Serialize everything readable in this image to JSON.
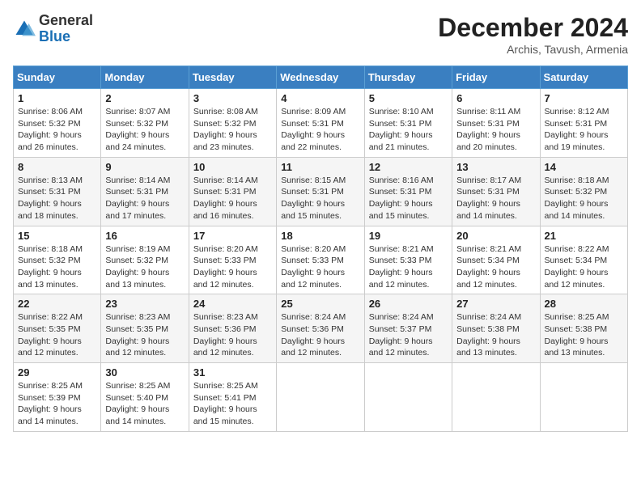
{
  "logo": {
    "general": "General",
    "blue": "Blue"
  },
  "title": "December 2024",
  "subtitle": "Archis, Tavush, Armenia",
  "days_of_week": [
    "Sunday",
    "Monday",
    "Tuesday",
    "Wednesday",
    "Thursday",
    "Friday",
    "Saturday"
  ],
  "weeks": [
    [
      {
        "day": "1",
        "sunrise": "8:06 AM",
        "sunset": "5:32 PM",
        "daylight": "9 hours and 26 minutes."
      },
      {
        "day": "2",
        "sunrise": "8:07 AM",
        "sunset": "5:32 PM",
        "daylight": "9 hours and 24 minutes."
      },
      {
        "day": "3",
        "sunrise": "8:08 AM",
        "sunset": "5:32 PM",
        "daylight": "9 hours and 23 minutes."
      },
      {
        "day": "4",
        "sunrise": "8:09 AM",
        "sunset": "5:31 PM",
        "daylight": "9 hours and 22 minutes."
      },
      {
        "day": "5",
        "sunrise": "8:10 AM",
        "sunset": "5:31 PM",
        "daylight": "9 hours and 21 minutes."
      },
      {
        "day": "6",
        "sunrise": "8:11 AM",
        "sunset": "5:31 PM",
        "daylight": "9 hours and 20 minutes."
      },
      {
        "day": "7",
        "sunrise": "8:12 AM",
        "sunset": "5:31 PM",
        "daylight": "9 hours and 19 minutes."
      }
    ],
    [
      {
        "day": "8",
        "sunrise": "8:13 AM",
        "sunset": "5:31 PM",
        "daylight": "9 hours and 18 minutes."
      },
      {
        "day": "9",
        "sunrise": "8:14 AM",
        "sunset": "5:31 PM",
        "daylight": "9 hours and 17 minutes."
      },
      {
        "day": "10",
        "sunrise": "8:14 AM",
        "sunset": "5:31 PM",
        "daylight": "9 hours and 16 minutes."
      },
      {
        "day": "11",
        "sunrise": "8:15 AM",
        "sunset": "5:31 PM",
        "daylight": "9 hours and 15 minutes."
      },
      {
        "day": "12",
        "sunrise": "8:16 AM",
        "sunset": "5:31 PM",
        "daylight": "9 hours and 15 minutes."
      },
      {
        "day": "13",
        "sunrise": "8:17 AM",
        "sunset": "5:31 PM",
        "daylight": "9 hours and 14 minutes."
      },
      {
        "day": "14",
        "sunrise": "8:18 AM",
        "sunset": "5:32 PM",
        "daylight": "9 hours and 14 minutes."
      }
    ],
    [
      {
        "day": "15",
        "sunrise": "8:18 AM",
        "sunset": "5:32 PM",
        "daylight": "9 hours and 13 minutes."
      },
      {
        "day": "16",
        "sunrise": "8:19 AM",
        "sunset": "5:32 PM",
        "daylight": "9 hours and 13 minutes."
      },
      {
        "day": "17",
        "sunrise": "8:20 AM",
        "sunset": "5:33 PM",
        "daylight": "9 hours and 12 minutes."
      },
      {
        "day": "18",
        "sunrise": "8:20 AM",
        "sunset": "5:33 PM",
        "daylight": "9 hours and 12 minutes."
      },
      {
        "day": "19",
        "sunrise": "8:21 AM",
        "sunset": "5:33 PM",
        "daylight": "9 hours and 12 minutes."
      },
      {
        "day": "20",
        "sunrise": "8:21 AM",
        "sunset": "5:34 PM",
        "daylight": "9 hours and 12 minutes."
      },
      {
        "day": "21",
        "sunrise": "8:22 AM",
        "sunset": "5:34 PM",
        "daylight": "9 hours and 12 minutes."
      }
    ],
    [
      {
        "day": "22",
        "sunrise": "8:22 AM",
        "sunset": "5:35 PM",
        "daylight": "9 hours and 12 minutes."
      },
      {
        "day": "23",
        "sunrise": "8:23 AM",
        "sunset": "5:35 PM",
        "daylight": "9 hours and 12 minutes."
      },
      {
        "day": "24",
        "sunrise": "8:23 AM",
        "sunset": "5:36 PM",
        "daylight": "9 hours and 12 minutes."
      },
      {
        "day": "25",
        "sunrise": "8:24 AM",
        "sunset": "5:36 PM",
        "daylight": "9 hours and 12 minutes."
      },
      {
        "day": "26",
        "sunrise": "8:24 AM",
        "sunset": "5:37 PM",
        "daylight": "9 hours and 12 minutes."
      },
      {
        "day": "27",
        "sunrise": "8:24 AM",
        "sunset": "5:38 PM",
        "daylight": "9 hours and 13 minutes."
      },
      {
        "day": "28",
        "sunrise": "8:25 AM",
        "sunset": "5:38 PM",
        "daylight": "9 hours and 13 minutes."
      }
    ],
    [
      {
        "day": "29",
        "sunrise": "8:25 AM",
        "sunset": "5:39 PM",
        "daylight": "9 hours and 14 minutes."
      },
      {
        "day": "30",
        "sunrise": "8:25 AM",
        "sunset": "5:40 PM",
        "daylight": "9 hours and 14 minutes."
      },
      {
        "day": "31",
        "sunrise": "8:25 AM",
        "sunset": "5:41 PM",
        "daylight": "9 hours and 15 minutes."
      },
      null,
      null,
      null,
      null
    ]
  ],
  "labels": {
    "sunrise": "Sunrise:",
    "sunset": "Sunset:",
    "daylight": "Daylight:"
  }
}
